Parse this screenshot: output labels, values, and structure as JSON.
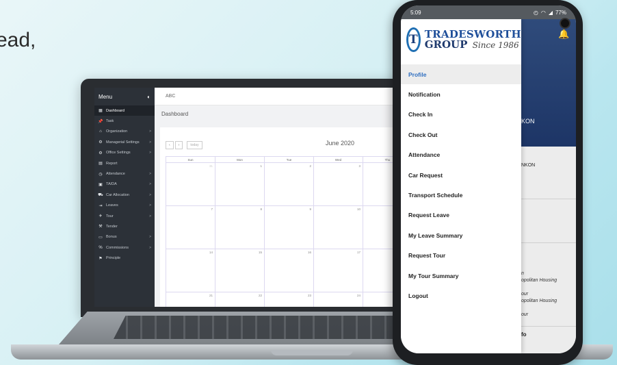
{
  "hero_text": "ead,",
  "laptop": {
    "sidebar": {
      "title": "Menu",
      "items": [
        {
          "label": "Dashboard",
          "icon": "▦",
          "chevron": ""
        },
        {
          "label": "Task",
          "icon": "📌",
          "chevron": ""
        },
        {
          "label": "Organization",
          "icon": "⌂",
          "chevron": ">"
        },
        {
          "label": "Managerial Settings",
          "icon": "⚙",
          "chevron": ">"
        },
        {
          "label": "Office Settings",
          "icon": "⚙",
          "chevron": ">"
        },
        {
          "label": "Report",
          "icon": "▤",
          "chevron": ""
        },
        {
          "label": "Attendance",
          "icon": "◷",
          "chevron": ">"
        },
        {
          "label": "TA/DA",
          "icon": "▣",
          "chevron": ">"
        },
        {
          "label": "Car Allocation",
          "icon": "⛟",
          "chevron": ">"
        },
        {
          "label": "Leaves",
          "icon": "⇥",
          "chevron": ">"
        },
        {
          "label": "Tour",
          "icon": "✈",
          "chevron": ">"
        },
        {
          "label": "Tender",
          "icon": "⚒",
          "chevron": ""
        },
        {
          "label": "Bonus",
          "icon": "▭",
          "chevron": ">"
        },
        {
          "label": "Commissions",
          "icon": "%",
          "chevron": ">"
        },
        {
          "label": "Principle",
          "icon": "⚑",
          "chevron": ""
        }
      ]
    },
    "topbar": "ABC",
    "breadcrumb": "Dashboard",
    "calendar": {
      "prev": "‹",
      "next": "›",
      "today": "today",
      "title": "June 2020",
      "days": [
        "Sun",
        "Mon",
        "Tue",
        "Wed",
        "Thu"
      ],
      "rows": [
        [
          "31",
          "1",
          "2",
          "3",
          ""
        ],
        [
          "7",
          "8",
          "9",
          "10",
          ""
        ],
        [
          "14",
          "15",
          "16",
          "17",
          ""
        ],
        [
          "21",
          "22",
          "23",
          "24",
          ""
        ]
      ]
    }
  },
  "phone": {
    "status": {
      "time": "5:09",
      "battery": "77%"
    },
    "logo": {
      "line1": "TRADESWORTH",
      "line2": "GROUP",
      "since": "Since 1986",
      "mark": "T"
    },
    "drawer_items": [
      "Profile",
      "Notification",
      "Check In",
      "Check Out",
      "Attendance",
      "Car Request",
      "Transport Schedule",
      "Request Leave",
      "My Leave Summary",
      "Request Tour",
      "My Tour Summary",
      "Logout"
    ],
    "behind": {
      "header_text": "KON",
      "line1": "NKON",
      "it1": "n",
      "it2": "opolitan Housing",
      "it3": "our",
      "it4": "opolitan Housing",
      "it5": "our",
      "bottom": "fo"
    }
  }
}
